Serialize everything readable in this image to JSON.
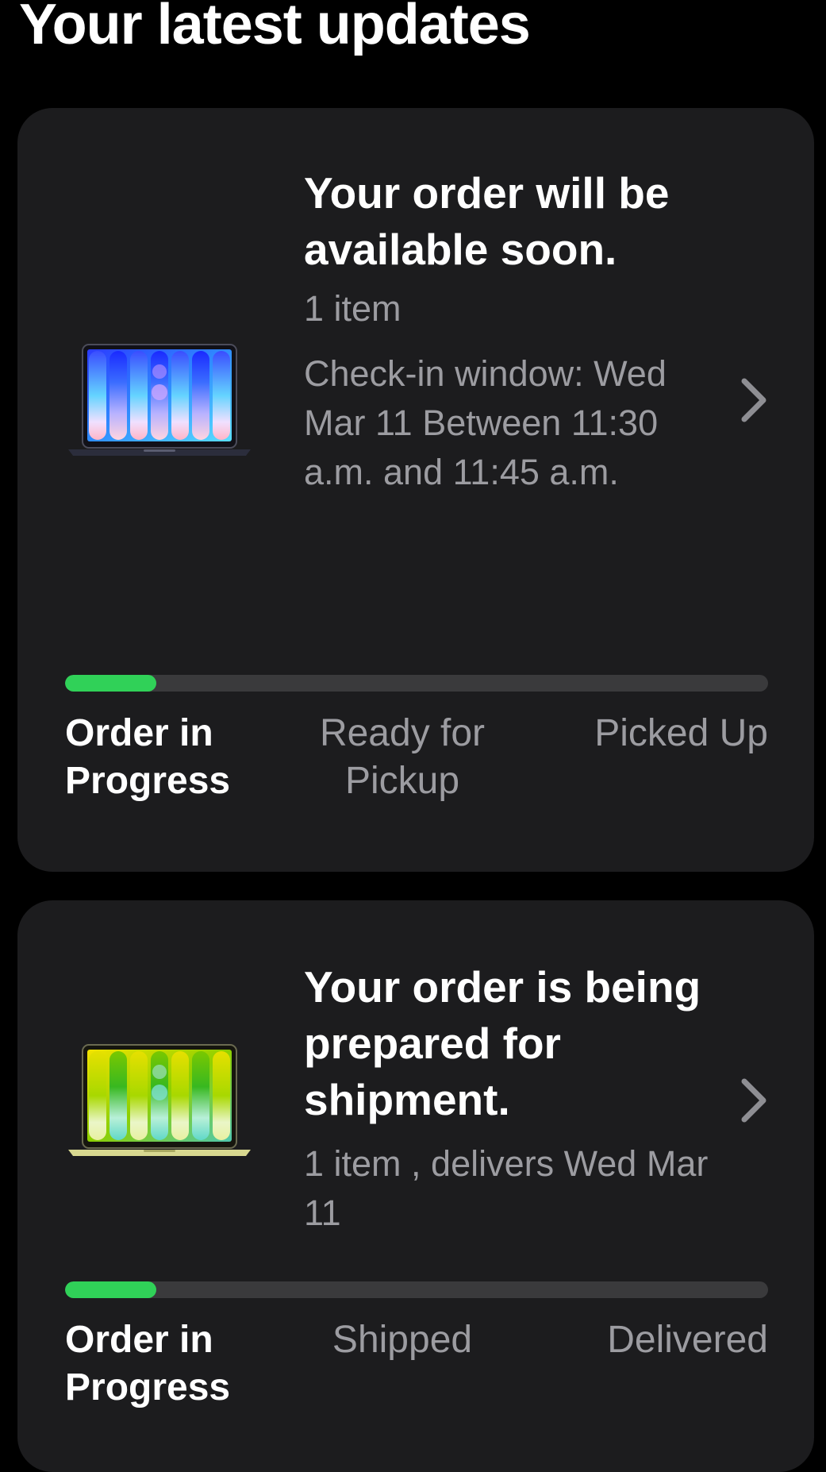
{
  "page": {
    "title": "Your latest updates"
  },
  "orders": [
    {
      "headline": "Your order will be available soon.",
      "item_count": "1 item",
      "checkin": "Check-in window: Wed Mar 11 Between 11:30 a.m. and 11:45 a.m.",
      "progress_fraction": 0.13,
      "steps": [
        "Order in Progress",
        "Ready for Pickup",
        "Picked Up"
      ],
      "active_step": 0,
      "product_image_icon": "macbook-midnight-icon"
    },
    {
      "headline": "Your order is being prepared for shipment.",
      "meta": "1 item , delivers Wed Mar 11",
      "progress_fraction": 0.13,
      "steps": [
        "Order in Progress",
        "Shipped",
        "Delivered"
      ],
      "active_step": 0,
      "product_image_icon": "macbook-yellow-icon"
    }
  ],
  "colors": {
    "background": "#000000",
    "card": "#1c1c1e",
    "progress_fill": "#30d158",
    "progress_track": "#3a3a3c",
    "secondary_text": "#9c9ca1"
  },
  "icons": {
    "chevron": "chevron-right-icon"
  }
}
